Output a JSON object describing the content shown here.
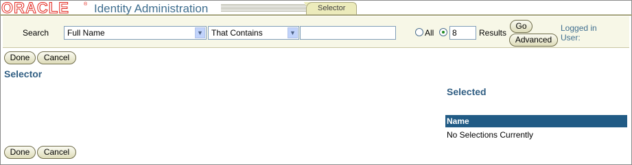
{
  "header": {
    "logo_text": "ORACLE",
    "logo_mark": "®",
    "app_title": "Identity Administration",
    "tab_label": "Selector"
  },
  "search": {
    "label": "Search",
    "attribute_select": "Full Name",
    "operator_select": "That Contains",
    "query_value": "",
    "all_label": "All",
    "results_count": "8",
    "results_label": "Results",
    "results_mode": "count",
    "go_label": "Go",
    "advanced_label": "Advanced",
    "logged_in_label": "Logged in User:"
  },
  "actions": {
    "done_label": "Done",
    "cancel_label": "Cancel"
  },
  "page": {
    "selector_heading": "Selector",
    "selected_heading": "Selected"
  },
  "selected_table": {
    "columns": [
      "Name"
    ],
    "empty_message": "No Selections Currently"
  },
  "colors": {
    "brand_red": "#e2231a",
    "title_blue": "#3f6e8f",
    "table_header_blue": "#215b85",
    "band_beige": "#f7f7e7"
  }
}
